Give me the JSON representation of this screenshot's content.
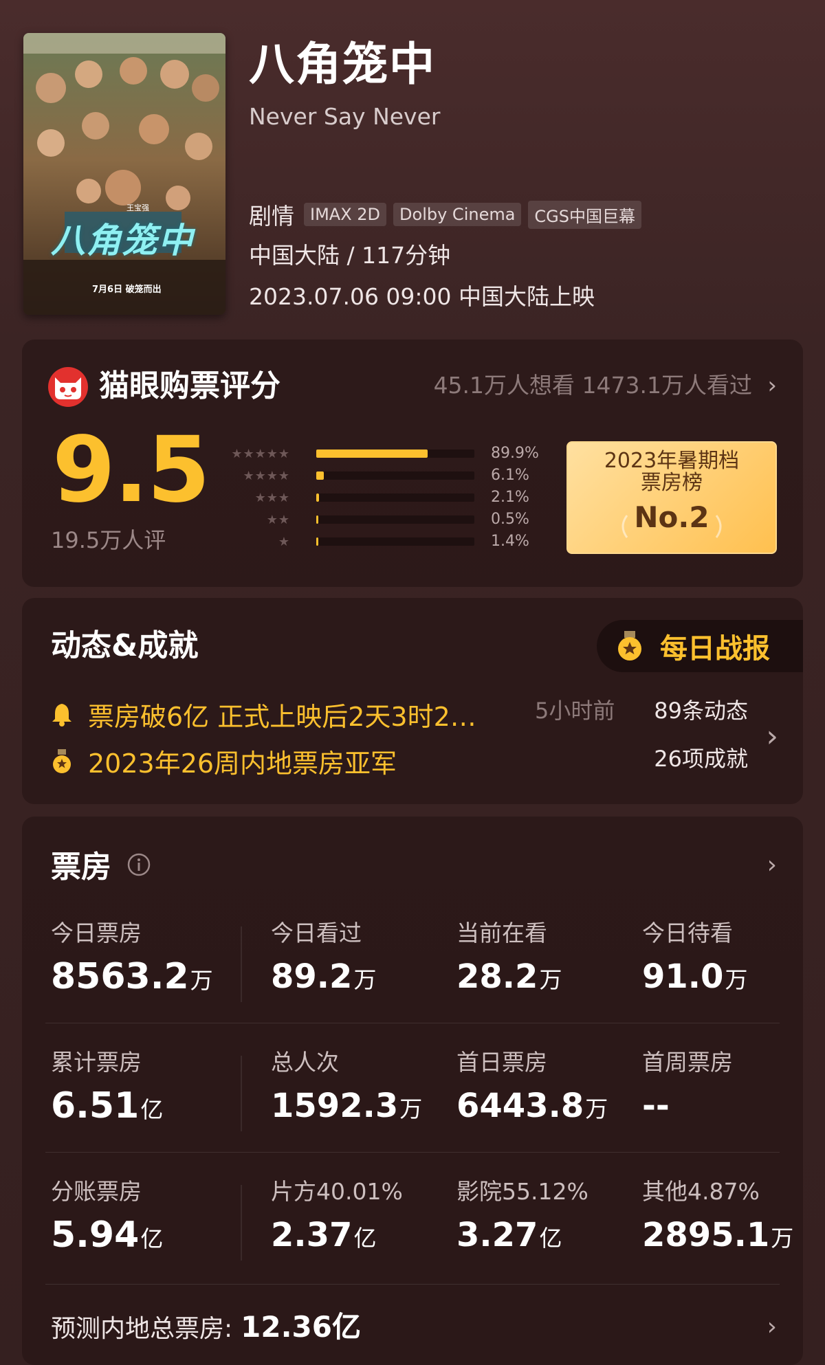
{
  "movie": {
    "title_cn": "八角笼中",
    "title_en": "Never Say Never",
    "genre": "剧情",
    "tags": [
      "IMAX 2D",
      "Dolby Cinema",
      "CGS中国巨幕"
    ],
    "region_duration": "中国大陆 / 117分钟",
    "release": "2023.07.06 09:00 中国大陆上映",
    "poster": {
      "title_art": "八角笼中",
      "release_note": "7月6日 破笼而出",
      "director": "王宝强"
    }
  },
  "rating": {
    "title": "猫眼购票评分",
    "summary": "45.1万人想看 1473.1万人看过",
    "score": "9.5",
    "count": "19.5万人评",
    "distribution": [
      {
        "stars": "★★★★★",
        "percent": "89.9%",
        "value": 0.899
      },
      {
        "stars": "★★★★",
        "percent": "6.1%",
        "value": 0.061
      },
      {
        "stars": "★★★",
        "percent": "2.1%",
        "value": 0.021
      },
      {
        "stars": "★★",
        "percent": "0.5%",
        "value": 0.005
      },
      {
        "stars": "★",
        "percent": "1.4%",
        "value": 0.014
      }
    ],
    "badge": {
      "line1": "2023年暑期档",
      "line2": "票房榜",
      "rank": "No.2"
    }
  },
  "dynamics": {
    "title": "动态&成就",
    "daily_report": "每日战报",
    "news": "票房破6亿 正式上映后2天3时2…",
    "news_time": "5小时前",
    "news_count": "89条动态",
    "achievement": "2023年26周内地票房亚军",
    "achievement_count": "26项成就"
  },
  "box_office": {
    "title": "票房",
    "rows": [
      [
        {
          "label": "今日票房",
          "value": "8563.2",
          "unit": "万"
        },
        {
          "label": "今日看过",
          "value": "89.2",
          "unit": "万"
        },
        {
          "label": "当前在看",
          "value": "28.2",
          "unit": "万"
        },
        {
          "label": "今日待看",
          "value": "91.0",
          "unit": "万"
        }
      ],
      [
        {
          "label": "累计票房",
          "value": "6.51",
          "unit": "亿"
        },
        {
          "label": "总人次",
          "value": "1592.3",
          "unit": "万"
        },
        {
          "label": "首日票房",
          "value": "6443.8",
          "unit": "万"
        },
        {
          "label": "首周票房",
          "value": "--",
          "unit": ""
        }
      ],
      [
        {
          "label": "分账票房",
          "value": "5.94",
          "unit": "亿"
        },
        {
          "label": "片方40.01%",
          "value": "2.37",
          "unit": "亿"
        },
        {
          "label": "影院55.12%",
          "value": "3.27",
          "unit": "亿"
        },
        {
          "label": "其他4.87%",
          "value": "2895.1",
          "unit": "万"
        }
      ]
    ],
    "forecast_label": "预测内地总票房:",
    "forecast_value": "12.36亿"
  },
  "colors": {
    "accent_gold": "#fcc02e",
    "background": "#3a2424",
    "maoyan_red": "#e2312e"
  }
}
